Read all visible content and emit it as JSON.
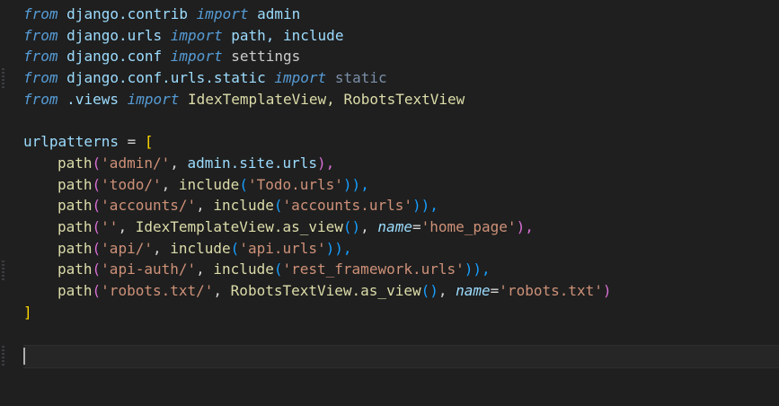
{
  "editor": {
    "language": "python",
    "colors": {
      "background": "#1f1f1f",
      "keyword": "#569cd6",
      "string": "#ce9178",
      "function": "#dcdcaa",
      "bracket_level_1": "#ffd700",
      "bracket_level_2": "#da70d6",
      "bracket_level_3": "#179fff"
    },
    "imports": [
      {
        "kw_from": "from",
        "module": "django.contrib",
        "kw_import": "import",
        "names": "admin"
      },
      {
        "kw_from": "from",
        "module": "django.urls",
        "kw_import": "import",
        "names": "path, include"
      },
      {
        "kw_from": "from",
        "module": "django.conf",
        "kw_import": "import",
        "names": "settings"
      },
      {
        "kw_from": "from",
        "module": "django.conf.urls.static",
        "kw_import": "import",
        "names": "static"
      },
      {
        "kw_from": "from",
        "module": ".views",
        "kw_import": "import",
        "names": "IdexTemplateView, RobotsTextView"
      }
    ],
    "urlpatterns": {
      "var": "urlpatterns",
      "assign": " = ",
      "open": "[",
      "close": "]",
      "entries": [
        {
          "fn": "path",
          "route": "'admin/'",
          "mid": ", ",
          "target": "admin.site.urls",
          "tail": "),"
        },
        {
          "fn": "path",
          "route": "'todo/'",
          "mid": ", ",
          "target_fn": "include",
          "target_arg": "'Todo.urls'",
          "tail": ")),"
        },
        {
          "fn": "path",
          "route": "'accounts/'",
          "mid": ", ",
          "target_fn": "include",
          "target_arg": "'accounts.urls'",
          "tail": ")),"
        },
        {
          "fn": "path",
          "route": "''",
          "mid": ", ",
          "target_cls": "IdexTemplateView",
          "target_method": ".as_view",
          "kwarg": "name",
          "kwarg_val": "'home_page'",
          "tail": "),"
        },
        {
          "fn": "path",
          "route": "'api/'",
          "mid": ", ",
          "target_fn": "include",
          "target_arg": "'api.urls'",
          "tail": ")),"
        },
        {
          "fn": "path",
          "route": "'api-auth/'",
          "mid": ", ",
          "target_fn": "include",
          "target_arg": "'rest_framework.urls'",
          "tail": ")),"
        },
        {
          "fn": "path",
          "route": "'robots.txt/'",
          "mid": ", ",
          "target_cls": "RobotsTextView",
          "target_method": ".as_view",
          "kwarg": "name",
          "kwarg_val": "'robots.txt'",
          "tail": ")"
        }
      ]
    }
  }
}
